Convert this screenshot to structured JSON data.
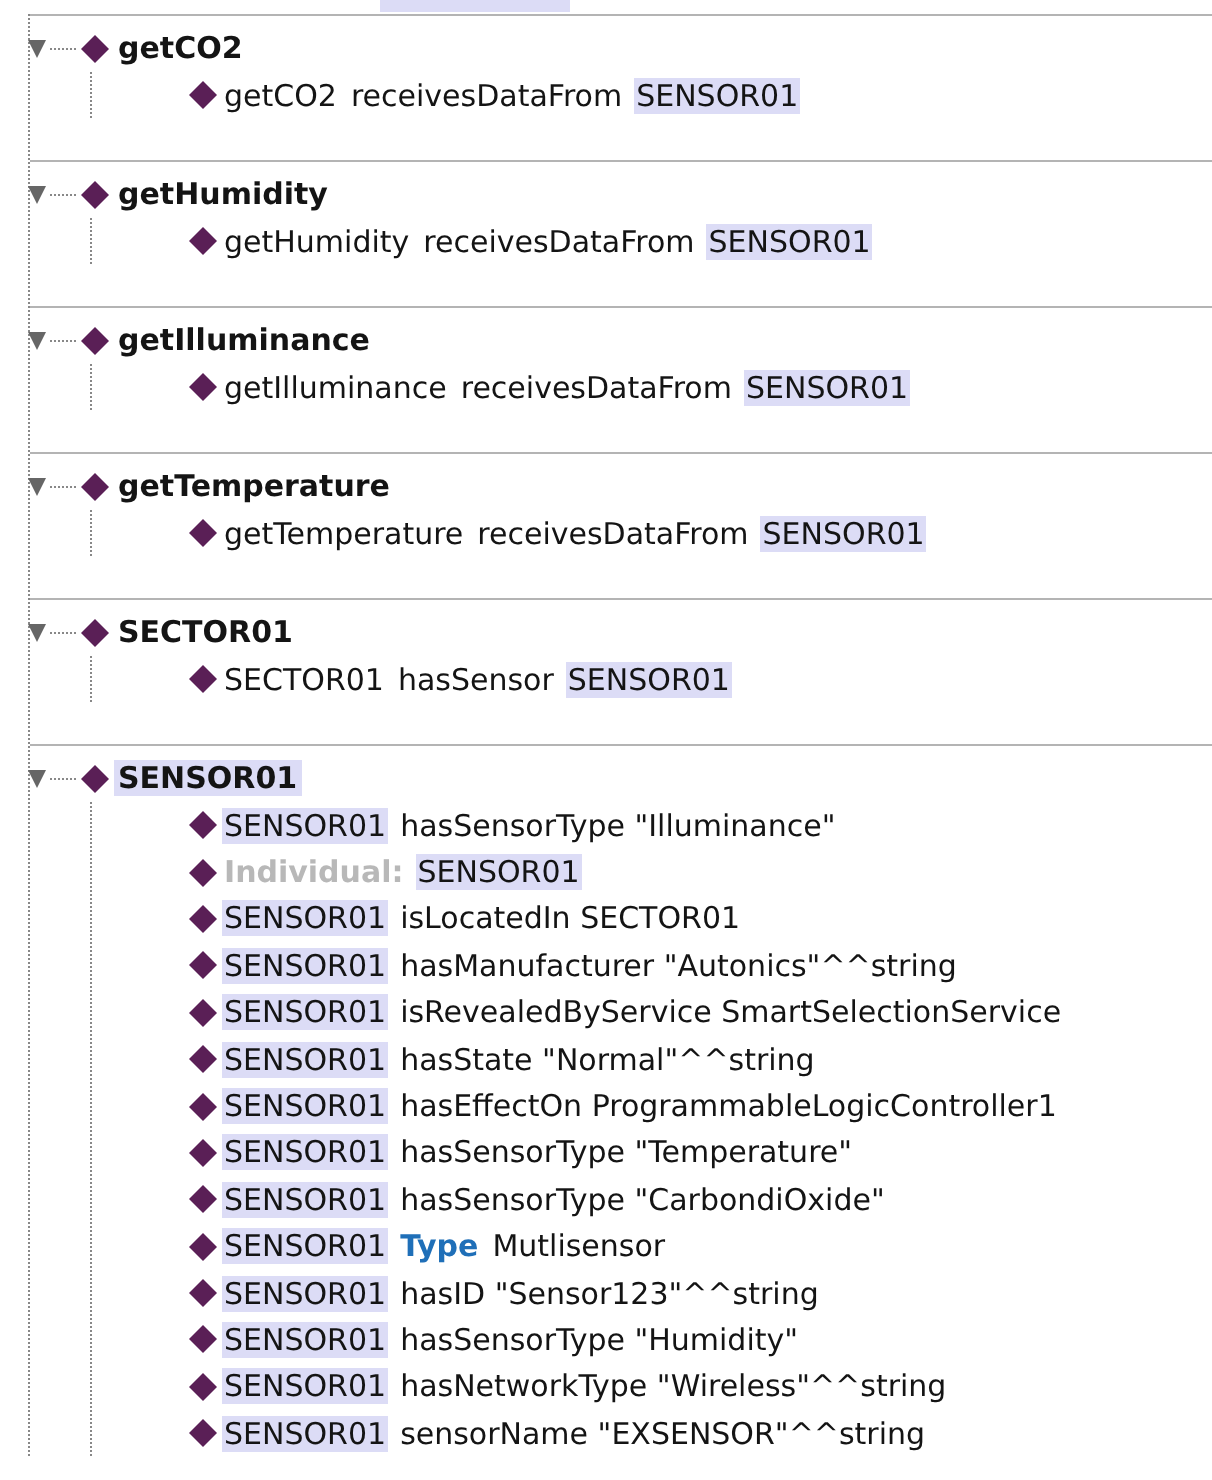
{
  "sections": [
    {
      "name": "getCO2",
      "highlighted": false,
      "expanded": true,
      "rows": [
        {
          "parts": [
            {
              "text": "getCO2",
              "kind": "plain"
            },
            {
              "text": "receivesDataFrom",
              "kind": "plain"
            },
            {
              "text": "SENSOR01",
              "kind": "highlight"
            }
          ]
        }
      ]
    },
    {
      "name": "getHumidity",
      "highlighted": false,
      "expanded": true,
      "rows": [
        {
          "parts": [
            {
              "text": "getHumidity",
              "kind": "plain"
            },
            {
              "text": "receivesDataFrom",
              "kind": "plain"
            },
            {
              "text": "SENSOR01",
              "kind": "highlight"
            }
          ]
        }
      ]
    },
    {
      "name": "getIlluminance",
      "highlighted": false,
      "expanded": true,
      "rows": [
        {
          "parts": [
            {
              "text": "getIlluminance",
              "kind": "plain"
            },
            {
              "text": "receivesDataFrom",
              "kind": "plain"
            },
            {
              "text": "SENSOR01",
              "kind": "highlight"
            }
          ]
        }
      ]
    },
    {
      "name": "getTemperature",
      "highlighted": false,
      "expanded": true,
      "rows": [
        {
          "parts": [
            {
              "text": "getTemperature",
              "kind": "plain"
            },
            {
              "text": "receivesDataFrom",
              "kind": "plain"
            },
            {
              "text": "SENSOR01",
              "kind": "highlight"
            }
          ]
        }
      ]
    },
    {
      "name": "SECTOR01",
      "highlighted": false,
      "expanded": true,
      "rows": [
        {
          "parts": [
            {
              "text": "SECTOR01",
              "kind": "plain"
            },
            {
              "text": "hasSensor",
              "kind": "plain"
            },
            {
              "text": "SENSOR01",
              "kind": "highlight"
            }
          ]
        }
      ]
    },
    {
      "name": "SENSOR01",
      "highlighted": true,
      "expanded": true,
      "rows": [
        {
          "parts": [
            {
              "text": "SENSOR01",
              "kind": "highlight"
            },
            {
              "text": "hasSensorType \"Illuminance\"",
              "kind": "plain"
            }
          ]
        },
        {
          "parts": [
            {
              "text": "Individual:",
              "kind": "label"
            },
            {
              "text": "SENSOR01",
              "kind": "highlight"
            }
          ]
        },
        {
          "parts": [
            {
              "text": "SENSOR01",
              "kind": "highlight"
            },
            {
              "text": "isLocatedIn SECTOR01",
              "kind": "plain"
            }
          ]
        },
        {
          "parts": [
            {
              "text": "SENSOR01",
              "kind": "highlight"
            },
            {
              "text": "hasManufacturer \"Autonics\"^^string",
              "kind": "plain"
            }
          ]
        },
        {
          "parts": [
            {
              "text": "SENSOR01",
              "kind": "highlight"
            },
            {
              "text": "isRevealedByService SmartSelectionService",
              "kind": "plain"
            }
          ]
        },
        {
          "parts": [
            {
              "text": "SENSOR01",
              "kind": "highlight"
            },
            {
              "text": "hasState \"Normal\"^^string",
              "kind": "plain"
            }
          ]
        },
        {
          "parts": [
            {
              "text": "SENSOR01",
              "kind": "highlight"
            },
            {
              "text": "hasEffectOn ProgrammableLogicController1",
              "kind": "plain"
            }
          ]
        },
        {
          "parts": [
            {
              "text": "SENSOR01",
              "kind": "highlight"
            },
            {
              "text": "hasSensorType \"Temperature\"",
              "kind": "plain"
            }
          ]
        },
        {
          "parts": [
            {
              "text": "SENSOR01",
              "kind": "highlight"
            },
            {
              "text": "hasSensorType \"CarbondiOxide\"",
              "kind": "plain"
            }
          ]
        },
        {
          "parts": [
            {
              "text": "SENSOR01",
              "kind": "highlight"
            },
            {
              "text": "Type",
              "kind": "keyword"
            },
            {
              "text": "Mutlisensor",
              "kind": "plain"
            }
          ]
        },
        {
          "parts": [
            {
              "text": "SENSOR01",
              "kind": "highlight"
            },
            {
              "text": "hasID \"Sensor123\"^^string",
              "kind": "plain"
            }
          ]
        },
        {
          "parts": [
            {
              "text": "SENSOR01",
              "kind": "highlight"
            },
            {
              "text": "hasSensorType \"Humidity\"",
              "kind": "plain"
            }
          ]
        },
        {
          "parts": [
            {
              "text": "SENSOR01",
              "kind": "highlight"
            },
            {
              "text": "hasNetworkType \"Wireless\"^^string",
              "kind": "plain"
            }
          ]
        },
        {
          "parts": [
            {
              "text": "SENSOR01",
              "kind": "highlight"
            },
            {
              "text": "sensorName \"EXSENSOR\"^^string",
              "kind": "plain"
            }
          ]
        }
      ]
    }
  ]
}
